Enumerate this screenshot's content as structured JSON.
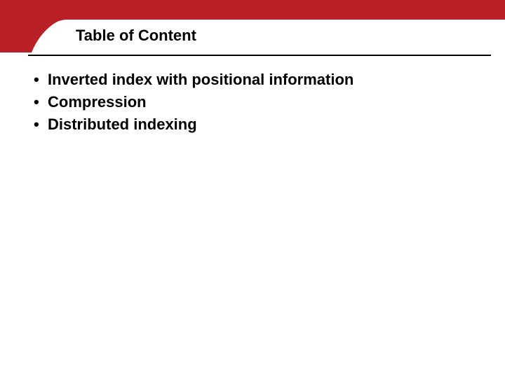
{
  "colors": {
    "accent": "#b92025"
  },
  "title": "Table of Content",
  "bullets": [
    "Inverted index with positional information",
    "Compression",
    "Distributed indexing"
  ]
}
